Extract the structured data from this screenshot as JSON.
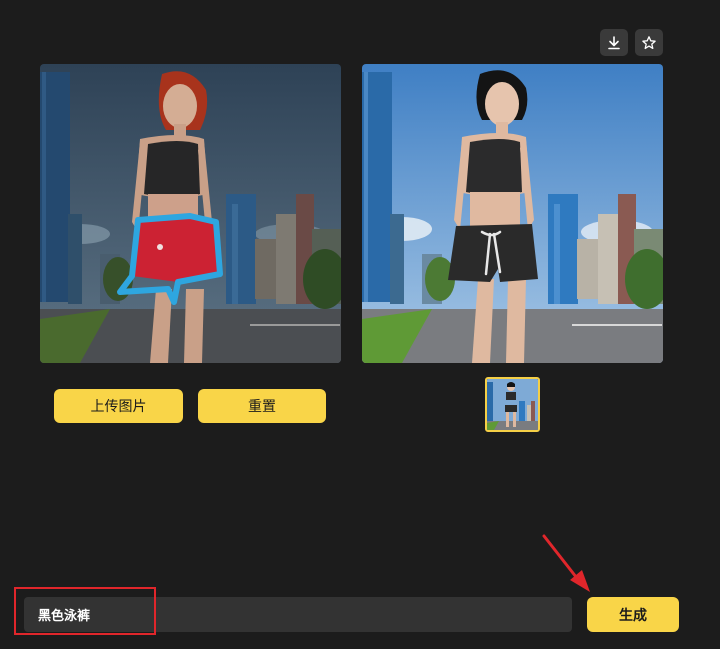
{
  "toolbar": {
    "download_icon": "download-icon",
    "favorite_icon": "star-icon"
  },
  "left_panel": {
    "upload_label": "上传图片",
    "reset_label": "重置",
    "mask_color": "#2ea6e0",
    "garment_color": "#cc2233"
  },
  "right_panel": {
    "shorts_color": "#2a2a2a"
  },
  "prompt": {
    "value": "黑色泳裤",
    "generate_label": "生成"
  },
  "colors": {
    "background": "#1c1c1c",
    "accent": "#f9d548",
    "highlight": "#e0262b"
  }
}
